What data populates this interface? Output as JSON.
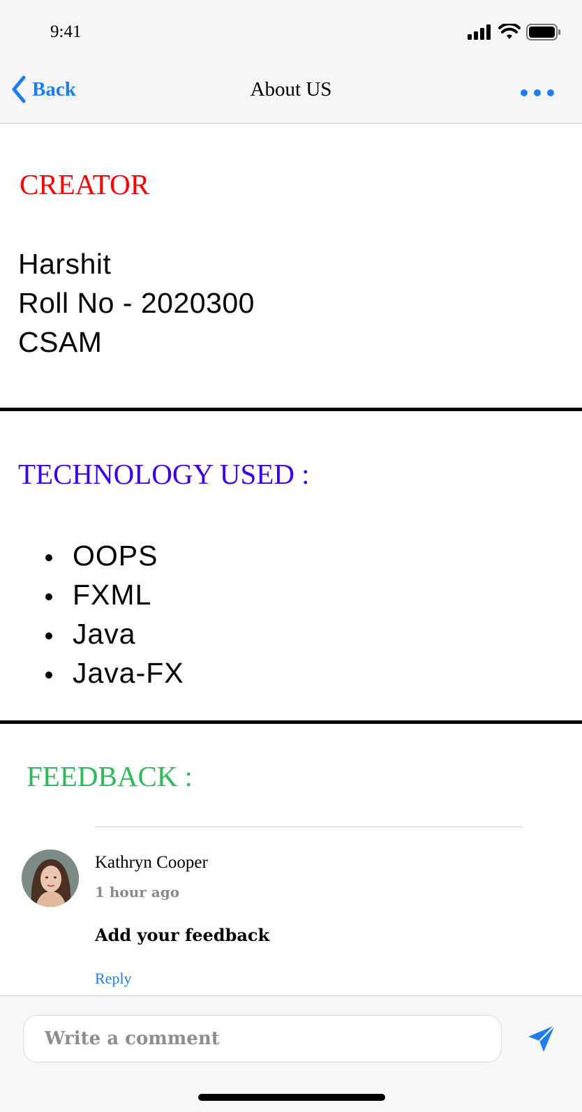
{
  "status_bar": {
    "time": "9:41"
  },
  "nav": {
    "back_label": "Back",
    "title": "About US"
  },
  "creator": {
    "heading": "CREATOR",
    "name": "Harshit",
    "roll": "Roll No - 2020300",
    "branch": "CSAM"
  },
  "technology": {
    "heading": "TECHNOLOGY USED :",
    "items": [
      "OOPS",
      "FXML",
      "Java",
      "Java-FX"
    ]
  },
  "feedback": {
    "heading": "FEEDBACK :",
    "comment": {
      "author": "Kathryn Cooper",
      "time": "1 hour ago",
      "text": "Add your feedback",
      "reply_label": "Reply"
    }
  },
  "composer": {
    "placeholder": "Write a comment"
  },
  "colors": {
    "accent": "#1e7ef0",
    "creator_heading": "#ff0000",
    "technology_heading": "#3c00ee",
    "feedback_heading": "#2dba5d"
  },
  "icons": [
    "signal-icon",
    "wifi-icon",
    "battery-icon",
    "back-chevron-icon",
    "more-icon",
    "send-icon"
  ]
}
